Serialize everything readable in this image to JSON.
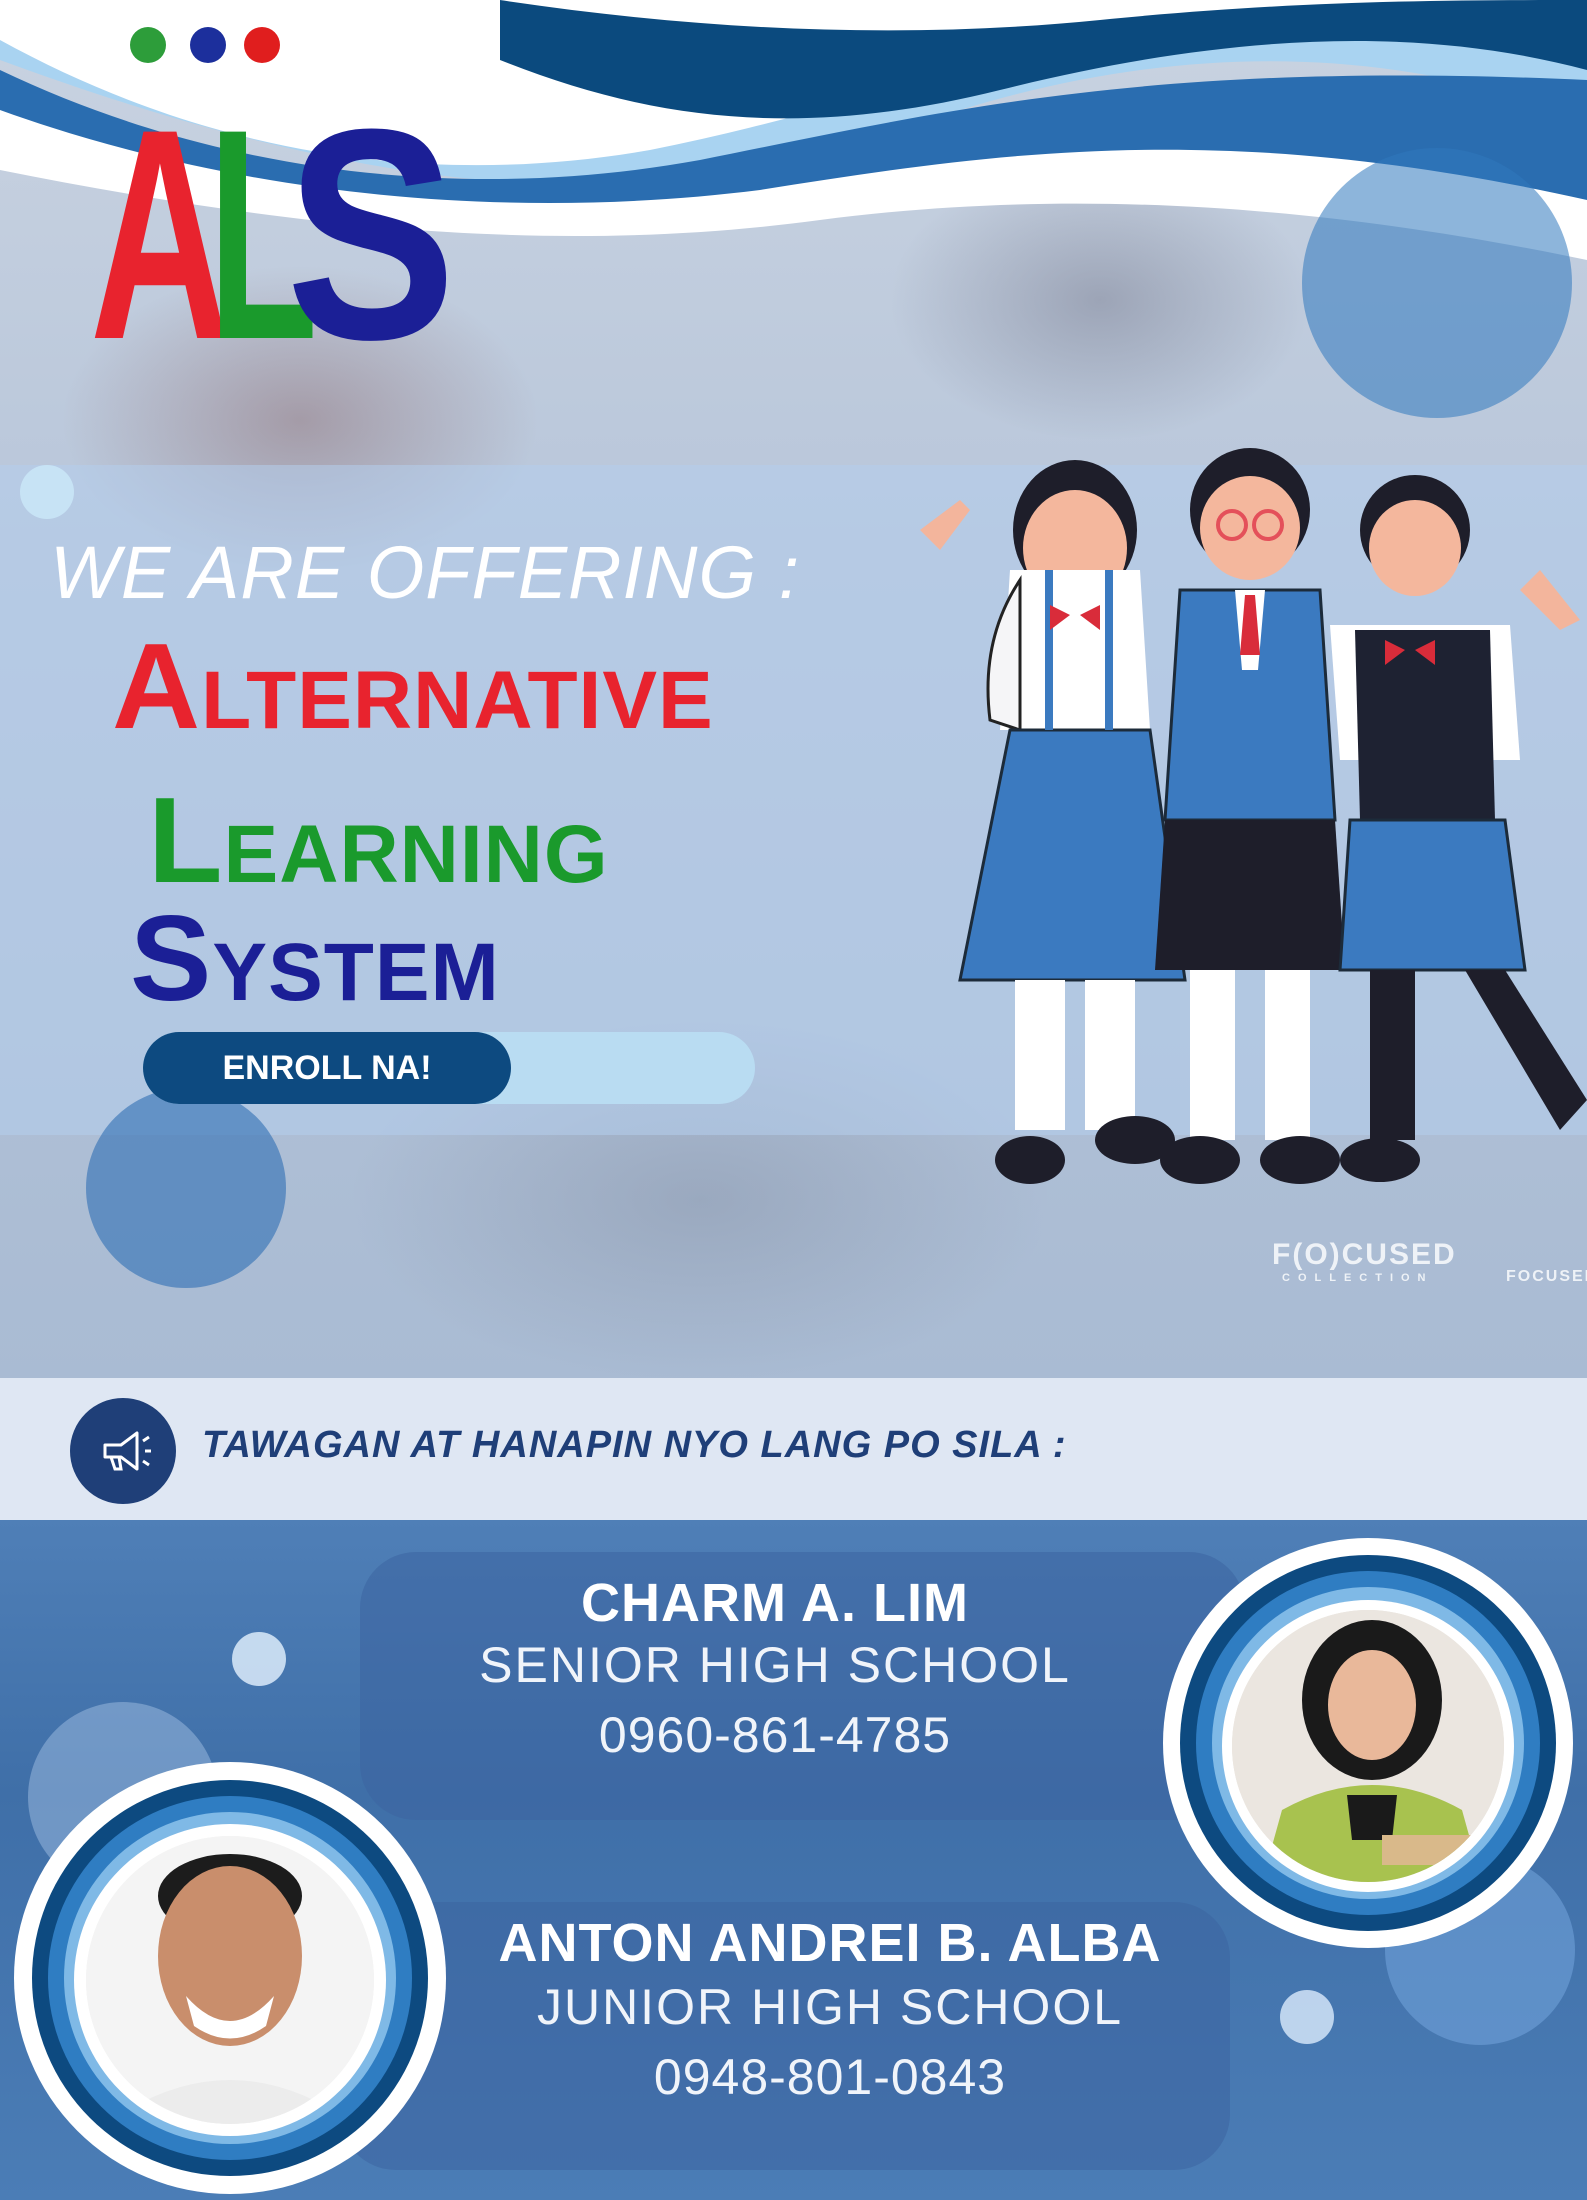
{
  "logo": {
    "text": "ALS",
    "dots": [
      "#2d9d3a",
      "#1c2f9c",
      "#e01e1e"
    ]
  },
  "headline": {
    "offering": "WE ARE OFFERING :",
    "lines": [
      {
        "first": "A",
        "rest": "LTERNATIVE",
        "color": "#e8232e"
      },
      {
        "first": "L",
        "rest": "EARNING",
        "color": "#1a9a2c"
      },
      {
        "first": "S",
        "rest": "YSTEM",
        "color": "#1b1f96"
      }
    ]
  },
  "enroll": {
    "label": "ENROLL NA!"
  },
  "watermark": {
    "brand": "F(O)CUSED",
    "sub": "COLLECTION",
    "small": "FOCUSED"
  },
  "contact": {
    "heading": "TAWAGAN AT HANAPIN NYO LANG PO SILA :"
  },
  "people": [
    {
      "name": "CHARM A. LIM",
      "level": "SENIOR HIGH SCHOOL",
      "phone": "0960-861-4785"
    },
    {
      "name": "ANTON ANDREI B. ALBA",
      "level": "JUNIOR HIGH SCHOOL",
      "phone": "0948-801-0843"
    }
  ],
  "colors": {
    "navy": "#1f3f78",
    "wave": "#2a6db0",
    "accent": "#0d4a80"
  }
}
